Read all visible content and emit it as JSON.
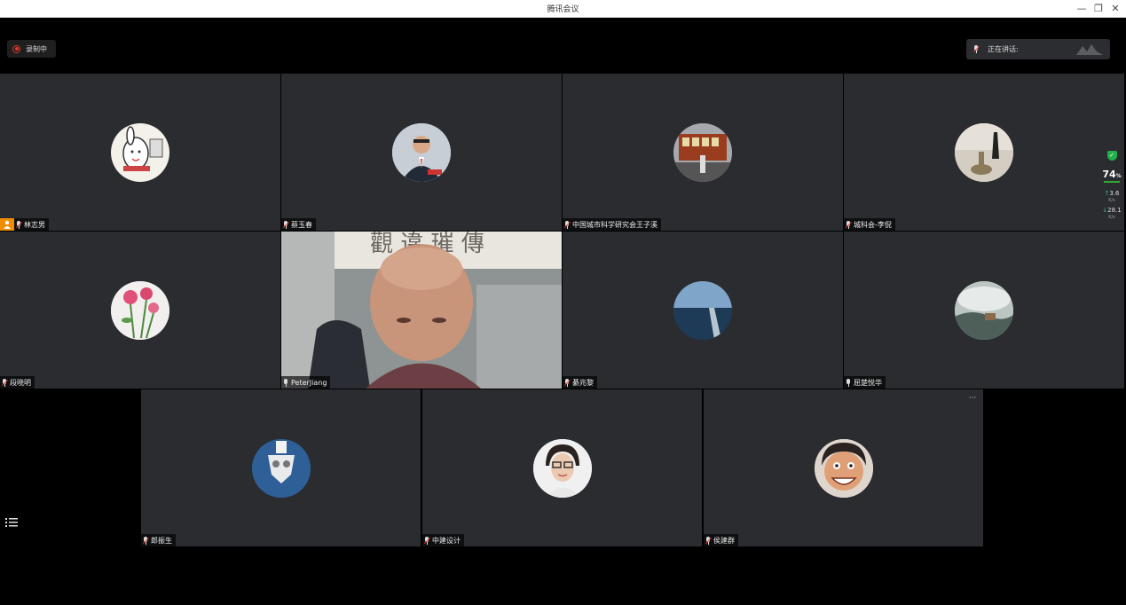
{
  "window": {
    "title": "腾讯会议",
    "minimize": "—",
    "restore": "❐",
    "close": "✕"
  },
  "recording": {
    "label": "录制中"
  },
  "speaking": {
    "label": "正在讲话:"
  },
  "stats": {
    "quality": "74",
    "quality_unit": "%",
    "up": "3.6",
    "up_unit": "K/s",
    "down": "28.1",
    "down_unit": "K/s"
  },
  "participants": [
    {
      "name": "林志男",
      "host": true,
      "muted": true,
      "avatar": "cartoon-rabbit"
    },
    {
      "name": "蔡玉春",
      "host": false,
      "muted": true,
      "avatar": "man-suit"
    },
    {
      "name": "中国城市科学研究会王子溪",
      "host": false,
      "muted": true,
      "avatar": "tram"
    },
    {
      "name": "城科会-李倪",
      "host": false,
      "muted": true,
      "avatar": "statue"
    },
    {
      "name": "段晓明",
      "host": false,
      "muted": true,
      "avatar": "flowers"
    },
    {
      "name": "PeterJiang",
      "host": false,
      "muted": false,
      "avatar": "video"
    },
    {
      "name": "綦兆黎",
      "host": false,
      "muted": true,
      "avatar": "ocean"
    },
    {
      "name": "屈楚悦华",
      "host": false,
      "muted": false,
      "avatar": "mist"
    },
    {
      "name": "郎振生",
      "host": false,
      "muted": true,
      "avatar": "emblem"
    },
    {
      "name": "中建设计",
      "host": false,
      "muted": true,
      "avatar": "woman-glasses"
    },
    {
      "name": "侯建群",
      "host": false,
      "muted": true,
      "avatar": "caricature"
    }
  ],
  "colors": {
    "tile": "#2a2c30",
    "accent_orange": "#f08c00",
    "record_red": "#e5392c",
    "shield_green": "#22b14c"
  }
}
